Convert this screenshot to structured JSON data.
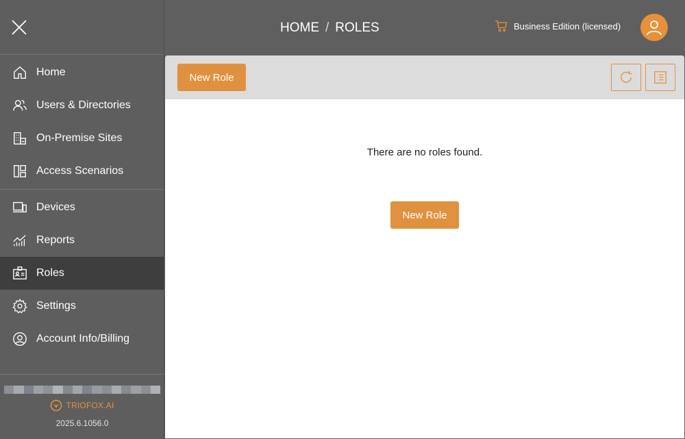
{
  "header": {
    "breadcrumb_home": "HOME",
    "breadcrumb_sep": "/",
    "breadcrumb_current": "ROLES",
    "edition_label": "Business Edition (licensed)"
  },
  "sidebar": {
    "group1": [
      {
        "label": "Home",
        "icon": "home-icon"
      },
      {
        "label": "Users & Directories",
        "icon": "users-icon"
      },
      {
        "label": "On-Premise Sites",
        "icon": "building-icon"
      },
      {
        "label": "Access Scenarios",
        "icon": "layout-icon"
      }
    ],
    "group2": [
      {
        "label": "Devices",
        "icon": "devices-icon"
      },
      {
        "label": "Reports",
        "icon": "reports-icon"
      },
      {
        "label": "Roles",
        "icon": "id-badge-icon",
        "active": true
      },
      {
        "label": "Settings",
        "icon": "gear-icon"
      },
      {
        "label": "Account Info/Billing",
        "icon": "account-icon"
      }
    ],
    "brand": "TRIOFOX.AI",
    "version": "2025.6.1056.0"
  },
  "toolbar": {
    "new_role_label": "New Role"
  },
  "main": {
    "empty_message": "There are no roles found.",
    "new_role_label": "New Role"
  },
  "colors": {
    "accent": "#e0913f",
    "sidebar_bg": "#5e5e5e",
    "active_bg": "#3e3e3e",
    "toolbar_bg": "#dcdcdc"
  }
}
